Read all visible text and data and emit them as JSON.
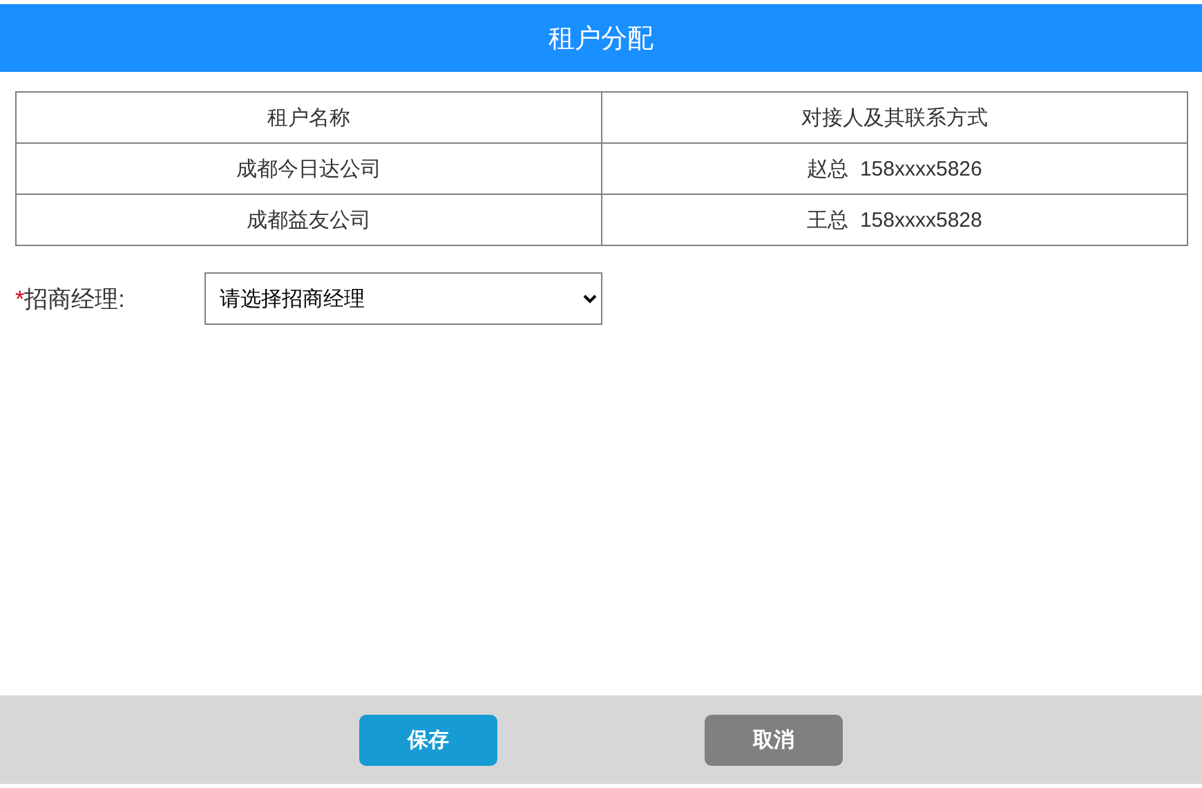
{
  "header": {
    "title": "租户分配"
  },
  "table": {
    "columns": [
      "租户名称",
      "对接人及其联系方式"
    ],
    "rows": [
      [
        "成都今日达公司",
        "赵总  158xxxx5826"
      ],
      [
        "成都益友公司",
        "王总  158xxxx5828"
      ]
    ]
  },
  "form": {
    "label": "招商经理:",
    "required_mark": "*",
    "select": {
      "value": "请选择招商经理"
    }
  },
  "buttons": [
    {
      "label": "保存",
      "kind": "primary"
    },
    {
      "label": "取消",
      "kind": "secondary"
    }
  ]
}
